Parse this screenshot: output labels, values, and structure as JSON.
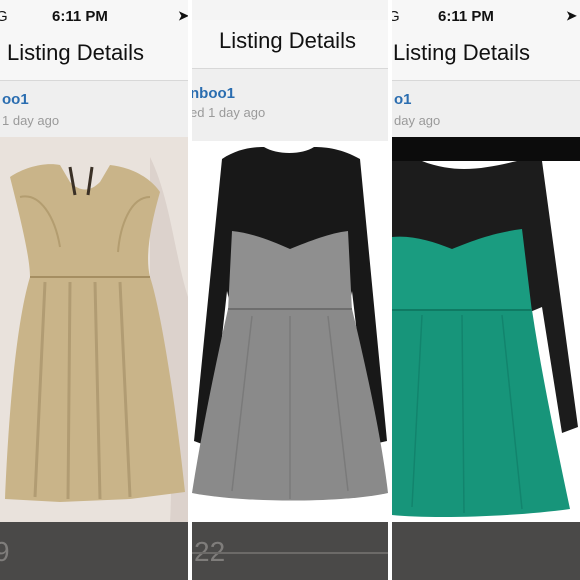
{
  "screens": [
    {
      "status": {
        "carrier": "G",
        "time": "6:11 PM",
        "location_icon": "location-arrow-icon"
      },
      "nav": {
        "title": "Listing Details"
      },
      "listing": {
        "username": "oo1",
        "posted": "1 day ago",
        "price": "9"
      },
      "photo": {
        "dress_color": "#c9b489",
        "background": "#e9e2dc"
      }
    },
    {
      "status": {
        "carrier": "",
        "time": "",
        "location_icon": ""
      },
      "nav": {
        "title": "Listing Details"
      },
      "listing": {
        "username": "nboo1",
        "posted": "ed 1 day ago",
        "price": "22"
      },
      "photo": {
        "dress_color": "#8f8f8f",
        "background": "#ffffff"
      }
    },
    {
      "status": {
        "carrier": "G",
        "time": "6:11 PM",
        "location_icon": "location-arrow-icon"
      },
      "nav": {
        "title": "Listing Details"
      },
      "listing": {
        "username": "o1",
        "posted": "day ago",
        "price": ""
      },
      "photo": {
        "dress_color": "#1a9c80",
        "background": "#ffffff"
      }
    }
  ]
}
